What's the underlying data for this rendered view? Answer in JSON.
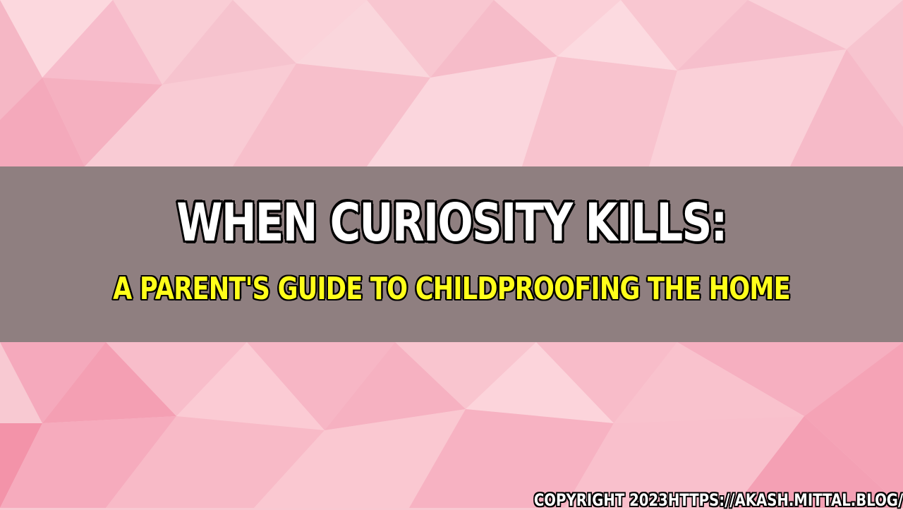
{
  "banner": {
    "title": "WHEN CURIOSITY KILLS:",
    "subtitle": "A PARENT'S GUIDE TO CHILDPROOFING THE HOME",
    "copyright": "COPYRIGHT 2023HTTPS://AKASH.MITTAL.BLOG/"
  },
  "colors": {
    "background": "#f8c9d2",
    "band": "#666260",
    "title": "#ffffff",
    "subtitle": "#ffff1a",
    "outline": "#000000"
  }
}
